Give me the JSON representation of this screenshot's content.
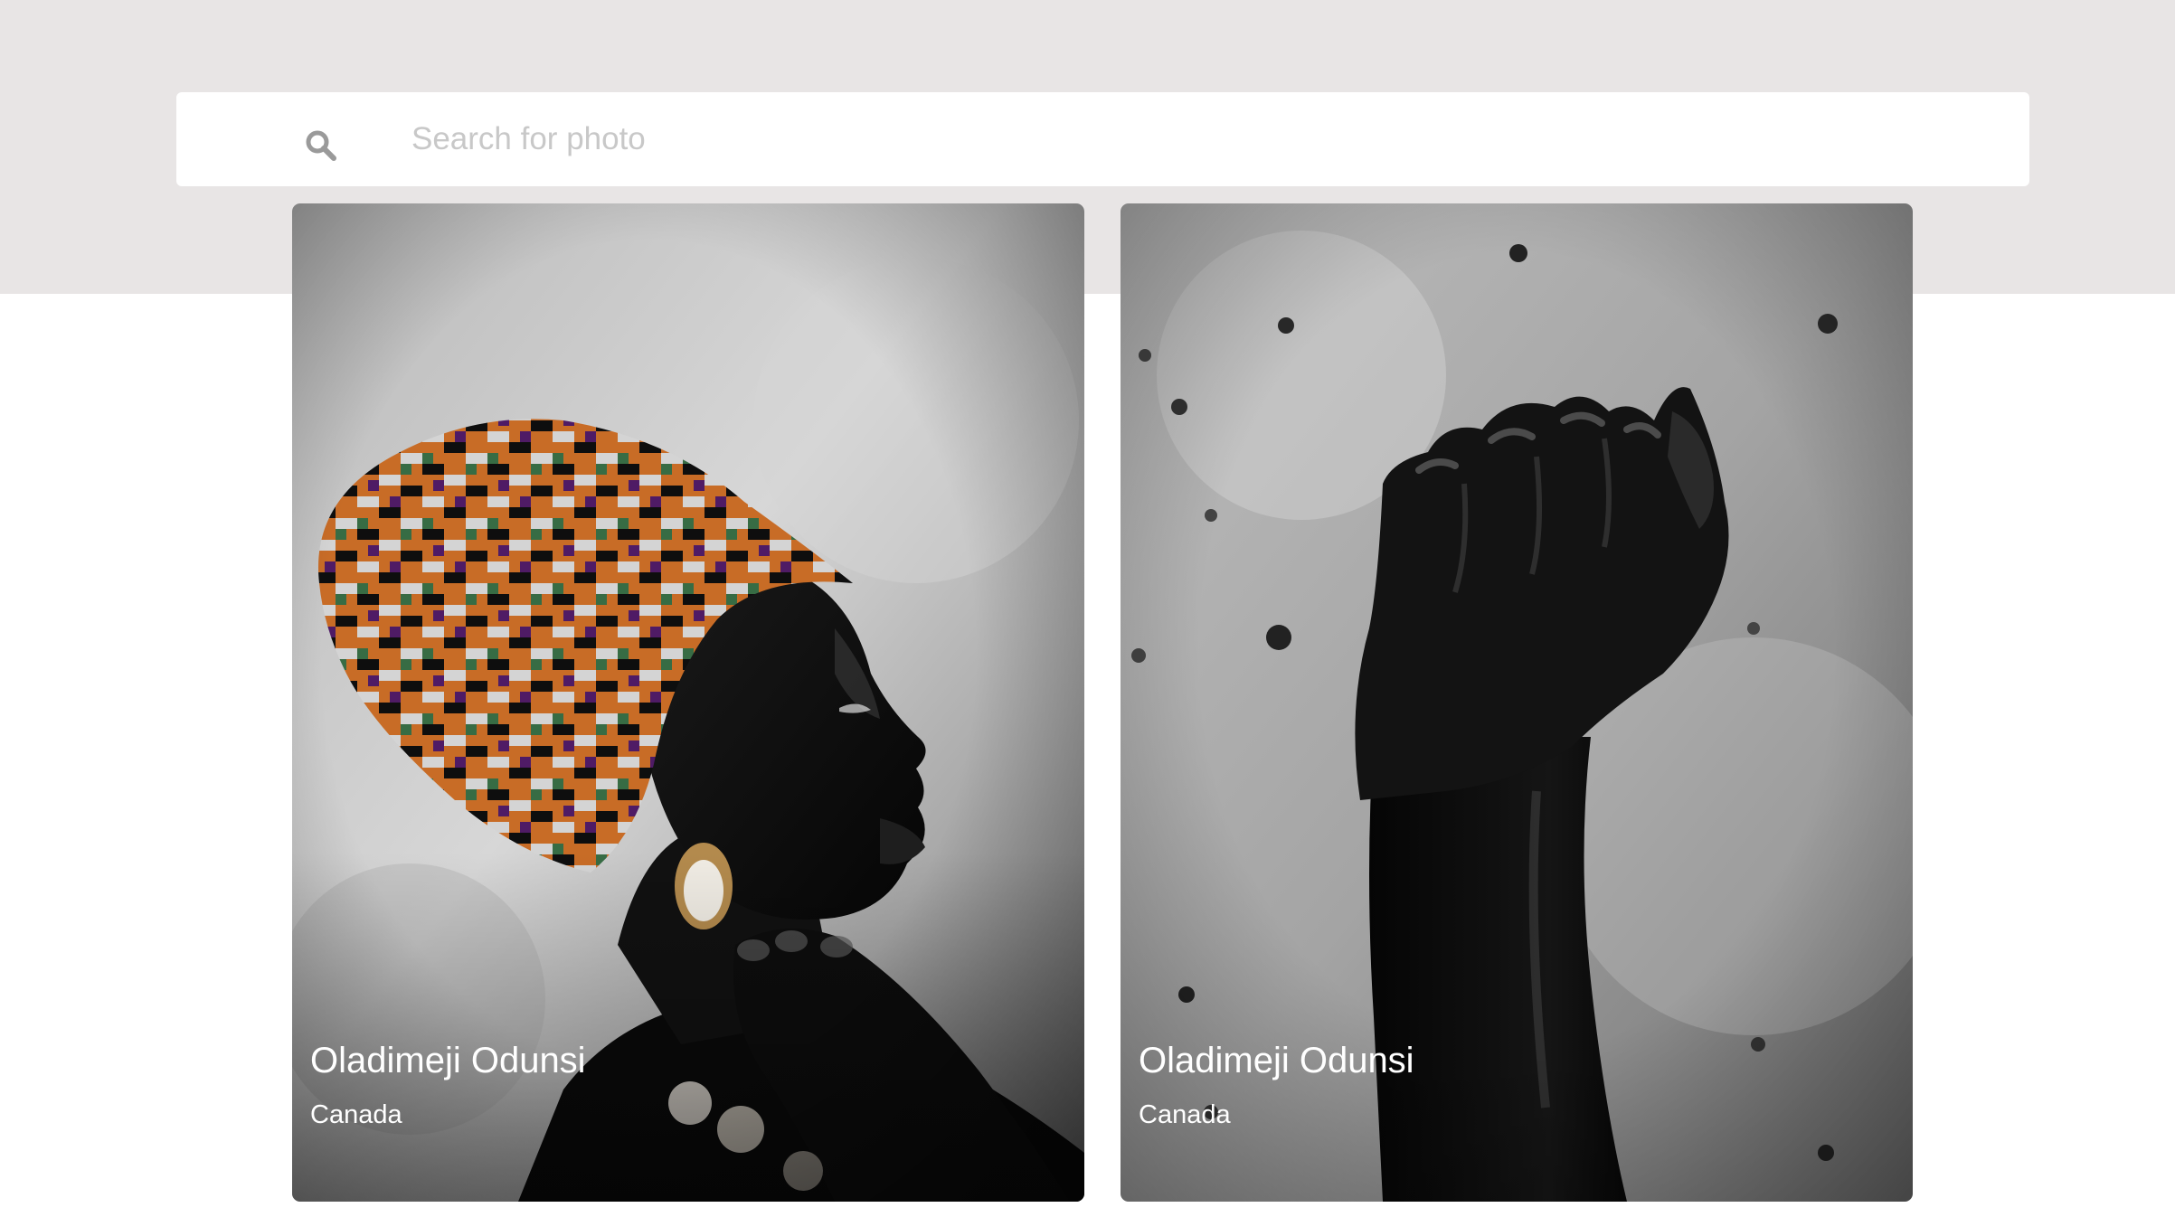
{
  "search": {
    "placeholder": "Search for photo",
    "value": "",
    "icon": "search-icon"
  },
  "colors": {
    "header_background": "#e8e5e5",
    "page_background": "#ffffff",
    "search_background": "#ffffff",
    "placeholder": "#c8c8c8",
    "icon": "#9a9a9a",
    "caption": "#ffffff"
  },
  "photos": [
    {
      "name": "Oladimeji Odunsi",
      "location": "Canada"
    },
    {
      "name": "Oladimeji Odunsi",
      "location": "Canada"
    }
  ]
}
